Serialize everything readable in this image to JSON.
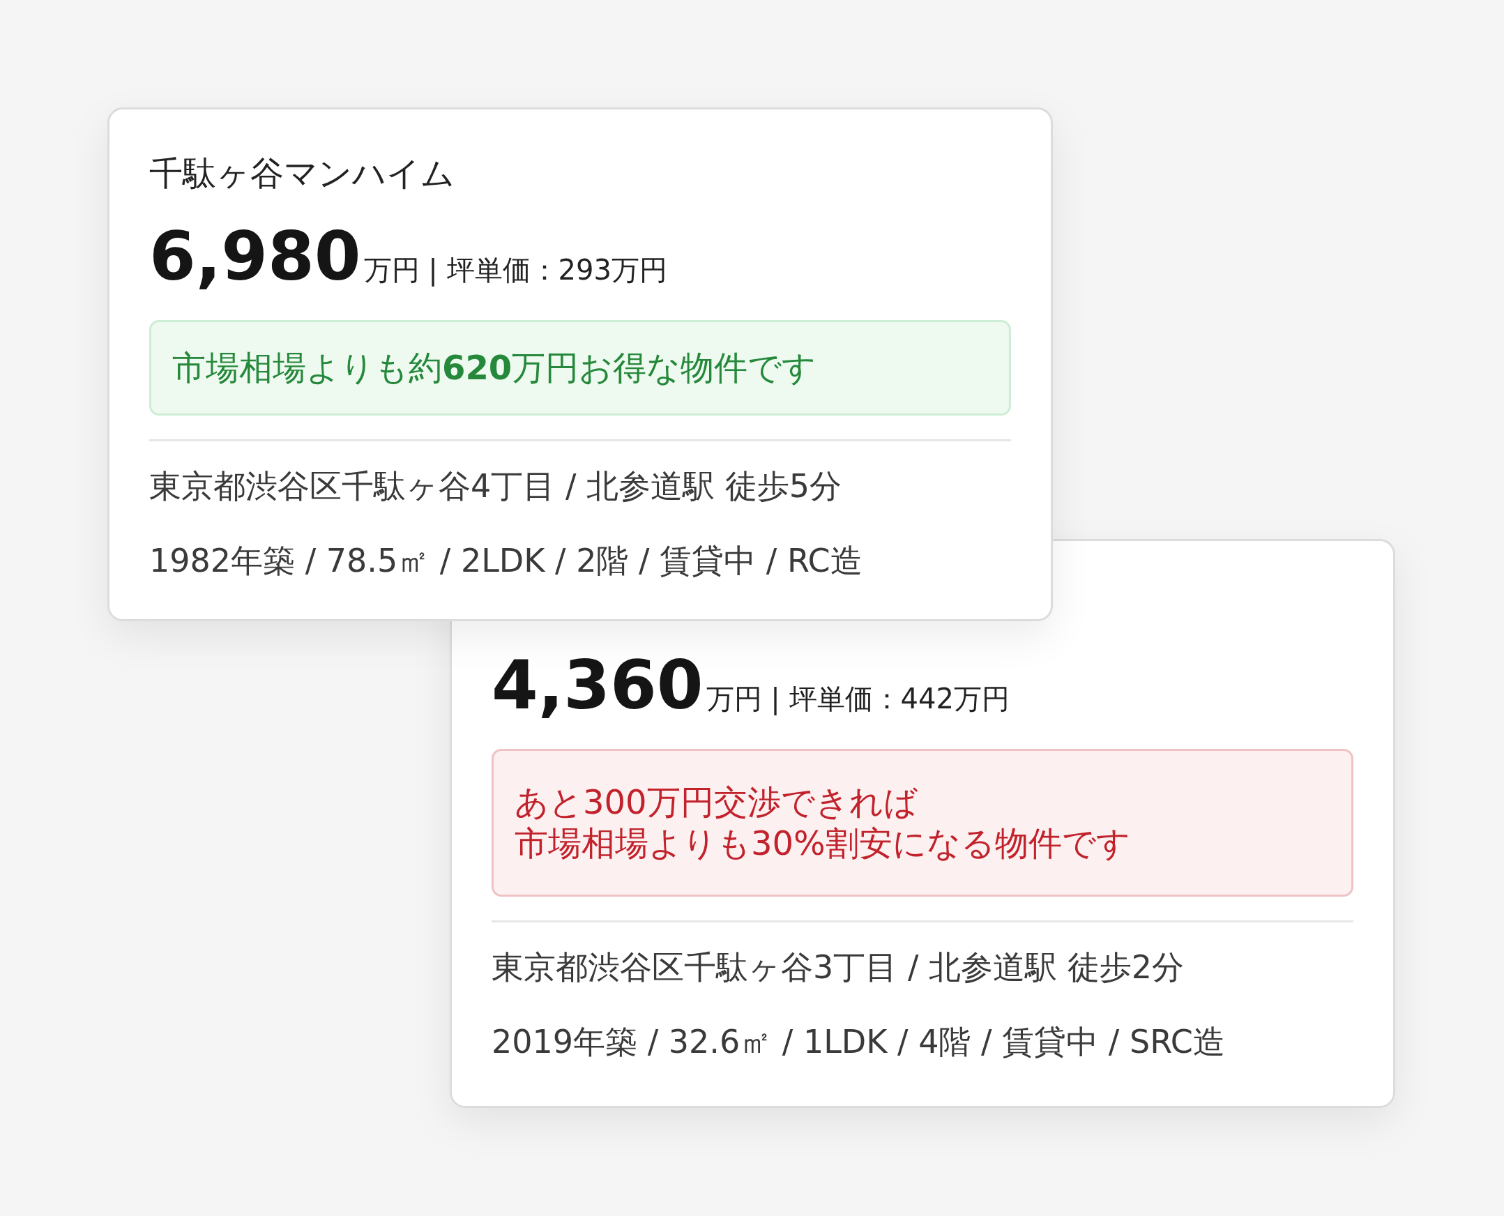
{
  "listings": [
    {
      "name": "千駄ヶ谷マンハイム",
      "price": "6,980",
      "price_suffix": "万円 | 坪単価：293万円",
      "note": {
        "kind": "good",
        "lines": [
          "市場相場よりも約**620**万円お得な物件です"
        ]
      },
      "address": "東京都渋谷区千駄ヶ谷4丁目 / 北参道駅 徒歩5分",
      "details": "1982年築 / 78.5㎡ / 2LDK / 2階 / 賃貸中 / RC造"
    },
    {
      "price": "4,360",
      "price_suffix": "万円 | 坪単価：442万円",
      "note": {
        "kind": "negotiable",
        "lines": [
          "あと300万円交渉できれば",
          "市場相場よりも30%割安になる物件です"
        ]
      },
      "address": "東京都渋谷区千駄ヶ谷3丁目 / 北参道駅 徒歩2分",
      "details": "2019年築 / 32.6㎡ / 1LDK / 4階 / 賃貸中 / SRC造"
    }
  ]
}
